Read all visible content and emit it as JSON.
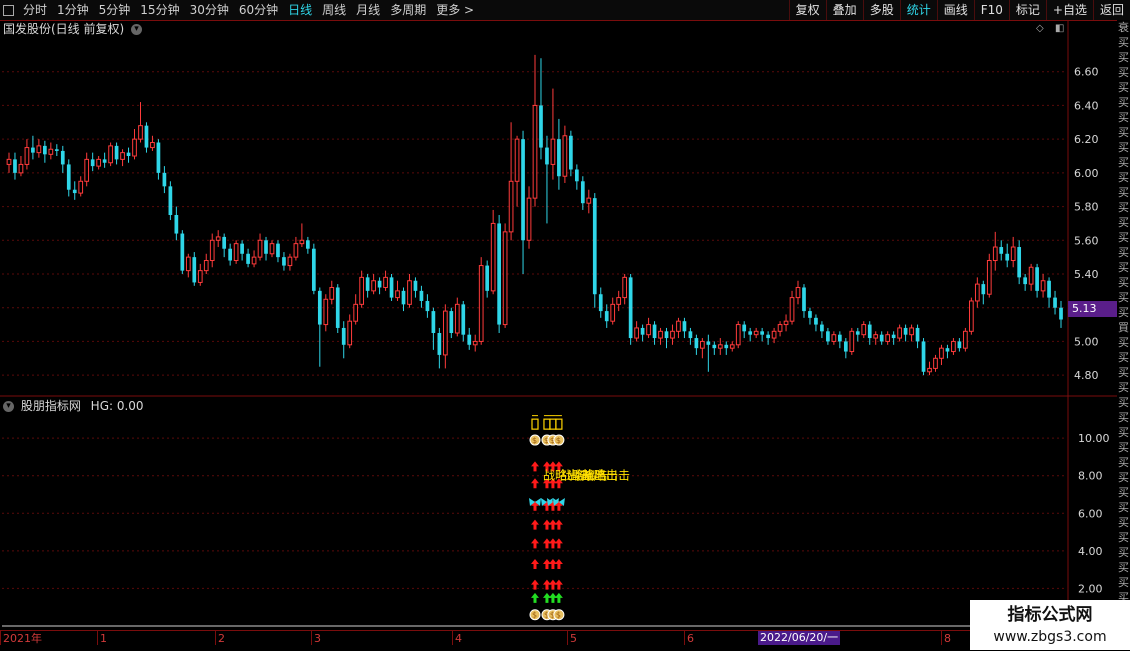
{
  "toolbar": {
    "periods": [
      {
        "label": "分时",
        "active": false
      },
      {
        "label": "1分钟",
        "active": false
      },
      {
        "label": "5分钟",
        "active": false
      },
      {
        "label": "15分钟",
        "active": false
      },
      {
        "label": "30分钟",
        "active": false
      },
      {
        "label": "60分钟",
        "active": false
      },
      {
        "label": "日线",
        "active": true
      },
      {
        "label": "周线",
        "active": false
      },
      {
        "label": "月线",
        "active": false
      },
      {
        "label": "多周期",
        "active": false
      },
      {
        "label": "更多 >",
        "active": false
      }
    ],
    "buttons": [
      {
        "label": "复权",
        "active": false
      },
      {
        "label": "叠加",
        "active": false
      },
      {
        "label": "多股",
        "active": false
      },
      {
        "label": "统计",
        "active": true
      },
      {
        "label": "画线",
        "active": false
      },
      {
        "label": "F10",
        "active": false
      },
      {
        "label": "标记",
        "active": false
      },
      {
        "label": "+自选",
        "active": false
      },
      {
        "label": "返回",
        "active": false
      }
    ]
  },
  "main_chart": {
    "title": "国发股份(日线 前复权)",
    "last_price": "5.13",
    "y_ticks": [
      "6.60",
      "6.40",
      "6.20",
      "6.00",
      "5.80",
      "5.60",
      "5.40",
      "5.20",
      "5.00",
      "4.80"
    ]
  },
  "indicator": {
    "title": "股朋指标网",
    "hg_label": "HG: 0.00",
    "y_ticks": [
      "10.00",
      "8.00",
      "6.00",
      "4.00",
      "2.00"
    ],
    "signal_text": "战略出击"
  },
  "x_axis": {
    "labels": [
      "2021年",
      "1",
      "2",
      "3",
      "4",
      "5",
      "6",
      "7",
      "8"
    ],
    "highlight": "2022/06/20/一"
  },
  "side_strip": [
    "衰",
    "买",
    "买",
    "买",
    "买",
    "买",
    "买",
    "买",
    "买",
    "买",
    "买",
    "买",
    "买",
    "买",
    "买",
    "买",
    "买",
    "买",
    "买",
    "买",
    "買",
    "买",
    "买",
    "买",
    "买",
    "买",
    "买",
    "买",
    "买",
    "买",
    "买",
    "买",
    "买",
    "买",
    "买",
    "买",
    "买",
    "买",
    "买",
    "买"
  ],
  "watermark": {
    "line1": "指标公式网",
    "line2": "www.zbgs3.com"
  },
  "colors": {
    "up": "#ff3b3b",
    "down": "#2fd6e8",
    "grid": "#7a0d0d",
    "accent": "#2fd6e8",
    "tag": "#5a1e8a"
  },
  "chart_data": {
    "type": "candlestick",
    "series_name": "国发股份",
    "ylim": [
      4.7,
      6.8
    ],
    "candles": [
      {
        "o": 6.05,
        "c": 6.08,
        "h": 6.12,
        "l": 6.0
      },
      {
        "o": 6.08,
        "c": 6.0,
        "h": 6.12,
        "l": 5.96
      },
      {
        "o": 6.0,
        "c": 6.05,
        "h": 6.1,
        "l": 5.98
      },
      {
        "o": 6.05,
        "c": 6.15,
        "h": 6.2,
        "l": 6.02
      },
      {
        "o": 6.15,
        "c": 6.12,
        "h": 6.22,
        "l": 6.08
      },
      {
        "o": 6.12,
        "c": 6.16,
        "h": 6.2,
        "l": 6.09
      },
      {
        "o": 6.16,
        "c": 6.11,
        "h": 6.19,
        "l": 6.06
      },
      {
        "o": 6.11,
        "c": 6.14,
        "h": 6.18,
        "l": 6.08
      },
      {
        "o": 6.14,
        "c": 6.13,
        "h": 6.17,
        "l": 6.1
      },
      {
        "o": 6.13,
        "c": 6.05,
        "h": 6.16,
        "l": 6.0
      },
      {
        "o": 6.05,
        "c": 5.9,
        "h": 6.08,
        "l": 5.86
      },
      {
        "o": 5.9,
        "c": 5.88,
        "h": 5.95,
        "l": 5.84
      },
      {
        "o": 5.88,
        "c": 5.95,
        "h": 5.98,
        "l": 5.86
      },
      {
        "o": 5.95,
        "c": 6.08,
        "h": 6.12,
        "l": 5.92
      },
      {
        "o": 6.08,
        "c": 6.04,
        "h": 6.12,
        "l": 6.01
      },
      {
        "o": 6.04,
        "c": 6.08,
        "h": 6.1,
        "l": 6.02
      },
      {
        "o": 6.08,
        "c": 6.06,
        "h": 6.12,
        "l": 6.03
      },
      {
        "o": 6.06,
        "c": 6.16,
        "h": 6.18,
        "l": 6.04
      },
      {
        "o": 6.16,
        "c": 6.08,
        "h": 6.18,
        "l": 6.05
      },
      {
        "o": 6.08,
        "c": 6.12,
        "h": 6.14,
        "l": 6.04
      },
      {
        "o": 6.12,
        "c": 6.1,
        "h": 6.15,
        "l": 6.06
      },
      {
        "o": 6.1,
        "c": 6.2,
        "h": 6.26,
        "l": 6.08
      },
      {
        "o": 6.2,
        "c": 6.28,
        "h": 6.42,
        "l": 6.18
      },
      {
        "o": 6.28,
        "c": 6.15,
        "h": 6.3,
        "l": 6.12
      },
      {
        "o": 6.15,
        "c": 6.18,
        "h": 6.22,
        "l": 6.13
      },
      {
        "o": 6.18,
        "c": 6.0,
        "h": 6.2,
        "l": 5.96
      },
      {
        "o": 6.0,
        "c": 5.92,
        "h": 6.04,
        "l": 5.88
      },
      {
        "o": 5.92,
        "c": 5.75,
        "h": 5.95,
        "l": 5.72
      },
      {
        "o": 5.75,
        "c": 5.64,
        "h": 5.8,
        "l": 5.6
      },
      {
        "o": 5.64,
        "c": 5.42,
        "h": 5.66,
        "l": 5.4
      },
      {
        "o": 5.42,
        "c": 5.5,
        "h": 5.52,
        "l": 5.38
      },
      {
        "o": 5.5,
        "c": 5.35,
        "h": 5.53,
        "l": 5.33
      },
      {
        "o": 5.35,
        "c": 5.42,
        "h": 5.46,
        "l": 5.33
      },
      {
        "o": 5.42,
        "c": 5.48,
        "h": 5.52,
        "l": 5.4
      },
      {
        "o": 5.48,
        "c": 5.6,
        "h": 5.64,
        "l": 5.44
      },
      {
        "o": 5.6,
        "c": 5.62,
        "h": 5.66,
        "l": 5.56
      },
      {
        "o": 5.62,
        "c": 5.55,
        "h": 5.64,
        "l": 5.5
      },
      {
        "o": 5.55,
        "c": 5.48,
        "h": 5.58,
        "l": 5.45
      },
      {
        "o": 5.48,
        "c": 5.58,
        "h": 5.6,
        "l": 5.46
      },
      {
        "o": 5.58,
        "c": 5.52,
        "h": 5.6,
        "l": 5.48
      },
      {
        "o": 5.52,
        "c": 5.46,
        "h": 5.55,
        "l": 5.44
      },
      {
        "o": 5.46,
        "c": 5.5,
        "h": 5.54,
        "l": 5.44
      },
      {
        "o": 5.5,
        "c": 5.6,
        "h": 5.64,
        "l": 5.48
      },
      {
        "o": 5.6,
        "c": 5.52,
        "h": 5.62,
        "l": 5.48
      },
      {
        "o": 5.52,
        "c": 5.58,
        "h": 5.6,
        "l": 5.5
      },
      {
        "o": 5.58,
        "c": 5.5,
        "h": 5.6,
        "l": 5.47
      },
      {
        "o": 5.5,
        "c": 5.45,
        "h": 5.53,
        "l": 5.42
      },
      {
        "o": 5.45,
        "c": 5.5,
        "h": 5.52,
        "l": 5.42
      },
      {
        "o": 5.5,
        "c": 5.58,
        "h": 5.62,
        "l": 5.48
      },
      {
        "o": 5.58,
        "c": 5.6,
        "h": 5.7,
        "l": 5.56
      },
      {
        "o": 5.6,
        "c": 5.55,
        "h": 5.62,
        "l": 5.52
      },
      {
        "o": 5.55,
        "c": 5.3,
        "h": 5.58,
        "l": 5.28
      },
      {
        "o": 5.3,
        "c": 5.1,
        "h": 5.32,
        "l": 4.85
      },
      {
        "o": 5.1,
        "c": 5.25,
        "h": 5.28,
        "l": 5.06
      },
      {
        "o": 5.25,
        "c": 5.32,
        "h": 5.36,
        "l": 5.22
      },
      {
        "o": 5.32,
        "c": 5.08,
        "h": 5.34,
        "l": 5.05
      },
      {
        "o": 5.08,
        "c": 4.98,
        "h": 5.12,
        "l": 4.9
      },
      {
        "o": 4.98,
        "c": 5.12,
        "h": 5.16,
        "l": 4.96
      },
      {
        "o": 5.12,
        "c": 5.22,
        "h": 5.28,
        "l": 5.1
      },
      {
        "o": 5.22,
        "c": 5.38,
        "h": 5.42,
        "l": 5.2
      },
      {
        "o": 5.38,
        "c": 5.3,
        "h": 5.4,
        "l": 5.26
      },
      {
        "o": 5.3,
        "c": 5.36,
        "h": 5.4,
        "l": 5.28
      },
      {
        "o": 5.36,
        "c": 5.32,
        "h": 5.38,
        "l": 5.28
      },
      {
        "o": 5.32,
        "c": 5.38,
        "h": 5.42,
        "l": 5.3
      },
      {
        "o": 5.38,
        "c": 5.26,
        "h": 5.4,
        "l": 5.24
      },
      {
        "o": 5.26,
        "c": 5.3,
        "h": 5.36,
        "l": 5.24
      },
      {
        "o": 5.3,
        "c": 5.22,
        "h": 5.32,
        "l": 5.18
      },
      {
        "o": 5.22,
        "c": 5.36,
        "h": 5.4,
        "l": 5.2
      },
      {
        "o": 5.36,
        "c": 5.3,
        "h": 5.38,
        "l": 5.26
      },
      {
        "o": 5.3,
        "c": 5.24,
        "h": 5.33,
        "l": 5.2
      },
      {
        "o": 5.24,
        "c": 5.18,
        "h": 5.28,
        "l": 5.14
      },
      {
        "o": 5.18,
        "c": 5.05,
        "h": 5.2,
        "l": 4.95
      },
      {
        "o": 5.05,
        "c": 4.92,
        "h": 5.08,
        "l": 4.84
      },
      {
        "o": 4.92,
        "c": 5.18,
        "h": 5.22,
        "l": 4.84
      },
      {
        "o": 5.18,
        "c": 5.05,
        "h": 5.2,
        "l": 5.02
      },
      {
        "o": 5.05,
        "c": 5.22,
        "h": 5.26,
        "l": 5.03
      },
      {
        "o": 5.22,
        "c": 5.04,
        "h": 5.24,
        "l": 5.0
      },
      {
        "o": 5.04,
        "c": 4.98,
        "h": 5.08,
        "l": 4.95
      },
      {
        "o": 4.98,
        "c": 5.0,
        "h": 5.04,
        "l": 4.94
      },
      {
        "o": 5.0,
        "c": 5.45,
        "h": 5.5,
        "l": 4.98
      },
      {
        "o": 5.45,
        "c": 5.3,
        "h": 5.48,
        "l": 5.26
      },
      {
        "o": 5.3,
        "c": 5.7,
        "h": 5.78,
        "l": 5.28
      },
      {
        "o": 5.7,
        "c": 5.1,
        "h": 5.75,
        "l": 5.05
      },
      {
        "o": 5.1,
        "c": 5.65,
        "h": 5.7,
        "l": 5.08
      },
      {
        "o": 5.65,
        "c": 5.95,
        "h": 6.3,
        "l": 5.6
      },
      {
        "o": 5.95,
        "c": 6.2,
        "h": 6.22,
        "l": 5.8
      },
      {
        "o": 6.2,
        "c": 5.6,
        "h": 6.25,
        "l": 5.4
      },
      {
        "o": 5.6,
        "c": 5.85,
        "h": 5.92,
        "l": 5.55
      },
      {
        "o": 5.85,
        "c": 6.4,
        "h": 6.7,
        "l": 5.8
      },
      {
        "o": 6.4,
        "c": 6.15,
        "h": 6.68,
        "l": 6.08
      },
      {
        "o": 6.15,
        "c": 6.05,
        "h": 6.22,
        "l": 5.7
      },
      {
        "o": 6.05,
        "c": 6.2,
        "h": 6.5,
        "l": 5.96
      },
      {
        "o": 6.2,
        "c": 5.98,
        "h": 6.32,
        "l": 5.9
      },
      {
        "o": 5.98,
        "c": 6.22,
        "h": 6.28,
        "l": 5.94
      },
      {
        "o": 6.22,
        "c": 6.02,
        "h": 6.25,
        "l": 5.98
      },
      {
        "o": 6.02,
        "c": 5.95,
        "h": 6.05,
        "l": 5.9
      },
      {
        "o": 5.95,
        "c": 5.82,
        "h": 5.98,
        "l": 5.78
      },
      {
        "o": 5.82,
        "c": 5.85,
        "h": 5.9,
        "l": 5.76
      },
      {
        "o": 5.85,
        "c": 5.28,
        "h": 5.88,
        "l": 5.2
      },
      {
        "o": 5.28,
        "c": 5.18,
        "h": 5.32,
        "l": 5.14
      },
      {
        "o": 5.18,
        "c": 5.12,
        "h": 5.22,
        "l": 5.08
      },
      {
        "o": 5.12,
        "c": 5.22,
        "h": 5.26,
        "l": 5.1
      },
      {
        "o": 5.22,
        "c": 5.26,
        "h": 5.3,
        "l": 5.18
      },
      {
        "o": 5.26,
        "c": 5.38,
        "h": 5.4,
        "l": 5.22
      },
      {
        "o": 5.38,
        "c": 5.02,
        "h": 5.4,
        "l": 4.98
      },
      {
        "o": 5.02,
        "c": 5.08,
        "h": 5.12,
        "l": 5.0
      },
      {
        "o": 5.08,
        "c": 5.04,
        "h": 5.1,
        "l": 5.0
      },
      {
        "o": 5.04,
        "c": 5.1,
        "h": 5.14,
        "l": 5.02
      },
      {
        "o": 5.1,
        "c": 5.02,
        "h": 5.12,
        "l": 4.98
      },
      {
        "o": 5.02,
        "c": 5.06,
        "h": 5.08,
        "l": 4.98
      },
      {
        "o": 5.06,
        "c": 5.02,
        "h": 5.08,
        "l": 4.96
      },
      {
        "o": 5.02,
        "c": 5.06,
        "h": 5.1,
        "l": 4.98
      },
      {
        "o": 5.06,
        "c": 5.12,
        "h": 5.14,
        "l": 5.02
      },
      {
        "o": 5.12,
        "c": 5.06,
        "h": 5.14,
        "l": 5.02
      },
      {
        "o": 5.06,
        "c": 5.02,
        "h": 5.08,
        "l": 4.98
      },
      {
        "o": 5.02,
        "c": 4.96,
        "h": 5.04,
        "l": 4.92
      },
      {
        "o": 4.96,
        "c": 5.0,
        "h": 5.02,
        "l": 4.9
      },
      {
        "o": 5.0,
        "c": 4.98,
        "h": 5.04,
        "l": 4.82
      },
      {
        "o": 4.98,
        "c": 4.96,
        "h": 5.0,
        "l": 4.92
      },
      {
        "o": 4.96,
        "c": 4.98,
        "h": 5.02,
        "l": 4.92
      },
      {
        "o": 4.98,
        "c": 4.96,
        "h": 5.0,
        "l": 4.92
      },
      {
        "o": 4.96,
        "c": 4.98,
        "h": 5.0,
        "l": 4.94
      },
      {
        "o": 4.98,
        "c": 5.1,
        "h": 5.12,
        "l": 4.96
      },
      {
        "o": 5.1,
        "c": 5.06,
        "h": 5.12,
        "l": 5.02
      },
      {
        "o": 5.06,
        "c": 5.04,
        "h": 5.08,
        "l": 5.0
      },
      {
        "o": 5.04,
        "c": 5.06,
        "h": 5.08,
        "l": 5.02
      },
      {
        "o": 5.06,
        "c": 5.04,
        "h": 5.08,
        "l": 5.0
      },
      {
        "o": 5.04,
        "c": 5.02,
        "h": 5.06,
        "l": 4.98
      },
      {
        "o": 5.02,
        "c": 5.06,
        "h": 5.08,
        "l": 4.99
      },
      {
        "o": 5.06,
        "c": 5.1,
        "h": 5.12,
        "l": 5.03
      },
      {
        "o": 5.1,
        "c": 5.12,
        "h": 5.16,
        "l": 5.06
      },
      {
        "o": 5.12,
        "c": 5.26,
        "h": 5.3,
        "l": 5.1
      },
      {
        "o": 5.26,
        "c": 5.32,
        "h": 5.36,
        "l": 5.22
      },
      {
        "o": 5.32,
        "c": 5.18,
        "h": 5.34,
        "l": 5.14
      },
      {
        "o": 5.18,
        "c": 5.14,
        "h": 5.2,
        "l": 5.1
      },
      {
        "o": 5.14,
        "c": 5.1,
        "h": 5.16,
        "l": 5.06
      },
      {
        "o": 5.1,
        "c": 5.06,
        "h": 5.12,
        "l": 5.02
      },
      {
        "o": 5.06,
        "c": 5.0,
        "h": 5.08,
        "l": 4.98
      },
      {
        "o": 5.0,
        "c": 5.04,
        "h": 5.06,
        "l": 4.98
      },
      {
        "o": 5.04,
        "c": 5.0,
        "h": 5.06,
        "l": 4.96
      },
      {
        "o": 5.0,
        "c": 4.94,
        "h": 5.02,
        "l": 4.9
      },
      {
        "o": 4.94,
        "c": 5.06,
        "h": 5.08,
        "l": 4.92
      },
      {
        "o": 5.06,
        "c": 5.04,
        "h": 5.08,
        "l": 5.0
      },
      {
        "o": 5.04,
        "c": 5.1,
        "h": 5.12,
        "l": 5.02
      },
      {
        "o": 5.1,
        "c": 5.02,
        "h": 5.12,
        "l": 4.98
      },
      {
        "o": 5.02,
        "c": 5.04,
        "h": 5.06,
        "l": 4.98
      },
      {
        "o": 5.04,
        "c": 5.0,
        "h": 5.06,
        "l": 4.98
      },
      {
        "o": 5.0,
        "c": 5.04,
        "h": 5.06,
        "l": 4.98
      },
      {
        "o": 5.04,
        "c": 5.02,
        "h": 5.06,
        "l": 4.98
      },
      {
        "o": 5.02,
        "c": 5.08,
        "h": 5.1,
        "l": 5.0
      },
      {
        "o": 5.08,
        "c": 5.04,
        "h": 5.1,
        "l": 5.0
      },
      {
        "o": 5.04,
        "c": 5.08,
        "h": 5.1,
        "l": 5.0
      },
      {
        "o": 5.08,
        "c": 5.0,
        "h": 5.1,
        "l": 4.96
      },
      {
        "o": 5.0,
        "c": 4.82,
        "h": 5.02,
        "l": 4.8
      },
      {
        "o": 4.82,
        "c": 4.84,
        "h": 4.88,
        "l": 4.8
      },
      {
        "o": 4.84,
        "c": 4.9,
        "h": 4.92,
        "l": 4.82
      },
      {
        "o": 4.9,
        "c": 4.96,
        "h": 4.98,
        "l": 4.86
      },
      {
        "o": 4.96,
        "c": 4.94,
        "h": 4.98,
        "l": 4.9
      },
      {
        "o": 4.94,
        "c": 5.0,
        "h": 5.02,
        "l": 4.92
      },
      {
        "o": 5.0,
        "c": 4.96,
        "h": 5.02,
        "l": 4.94
      },
      {
        "o": 4.96,
        "c": 5.06,
        "h": 5.08,
        "l": 4.94
      },
      {
        "o": 5.06,
        "c": 5.24,
        "h": 5.26,
        "l": 5.04
      },
      {
        "o": 5.24,
        "c": 5.34,
        "h": 5.38,
        "l": 5.2
      },
      {
        "o": 5.34,
        "c": 5.28,
        "h": 5.36,
        "l": 5.22
      },
      {
        "o": 5.28,
        "c": 5.48,
        "h": 5.52,
        "l": 5.26
      },
      {
        "o": 5.48,
        "c": 5.56,
        "h": 5.65,
        "l": 5.42
      },
      {
        "o": 5.56,
        "c": 5.52,
        "h": 5.6,
        "l": 5.48
      },
      {
        "o": 5.52,
        "c": 5.48,
        "h": 5.58,
        "l": 5.44
      },
      {
        "o": 5.48,
        "c": 5.56,
        "h": 5.62,
        "l": 5.44
      },
      {
        "o": 5.56,
        "c": 5.38,
        "h": 5.6,
        "l": 5.34
      },
      {
        "o": 5.38,
        "c": 5.34,
        "h": 5.4,
        "l": 5.3
      },
      {
        "o": 5.34,
        "c": 5.44,
        "h": 5.46,
        "l": 5.3
      },
      {
        "o": 5.44,
        "c": 5.3,
        "h": 5.46,
        "l": 5.26
      },
      {
        "o": 5.3,
        "c": 5.36,
        "h": 5.4,
        "l": 5.26
      },
      {
        "o": 5.36,
        "c": 5.26,
        "h": 5.38,
        "l": 5.2
      },
      {
        "o": 5.26,
        "c": 5.2,
        "h": 5.3,
        "l": 5.16
      },
      {
        "o": 5.2,
        "c": 5.13,
        "h": 5.24,
        "l": 5.08
      }
    ],
    "indicator_signals": {
      "bars": [
        {
          "index": 88,
          "gold": true,
          "butterfly": true,
          "red_arrows": true
        },
        {
          "index": 90,
          "gold": true,
          "butterfly": true,
          "red_arrows": true
        },
        {
          "index": 91,
          "gold": true,
          "butterfly": true,
          "red_arrows": true
        },
        {
          "index": 92,
          "gold": true,
          "butterfly": true,
          "red_arrows": true
        }
      ],
      "text": "战略出击"
    }
  }
}
